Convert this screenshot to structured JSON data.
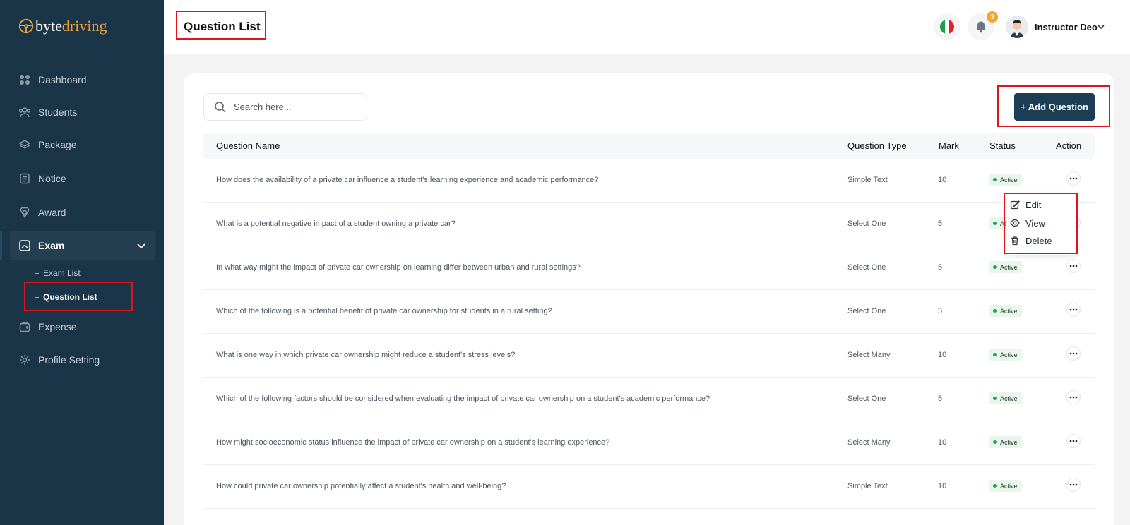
{
  "brand": {
    "name_part1": "byte",
    "name_part2": "driving"
  },
  "sidebar": {
    "items": [
      {
        "label": "Dashboard",
        "icon": "grid-icon"
      },
      {
        "label": "Students",
        "icon": "users-icon"
      },
      {
        "label": "Package",
        "icon": "layers-icon"
      },
      {
        "label": "Notice",
        "icon": "notice-icon"
      },
      {
        "label": "Award",
        "icon": "award-icon"
      },
      {
        "label": "Exam",
        "icon": "exam-icon"
      },
      {
        "label": "Expense",
        "icon": "wallet-icon"
      },
      {
        "label": "Profile Setting",
        "icon": "gear-icon"
      }
    ],
    "sub_items": [
      {
        "label": "Exam List"
      },
      {
        "label": "Question List"
      }
    ]
  },
  "header": {
    "title": "Question List",
    "notification_count": "3",
    "user_name": "Instructor Deo"
  },
  "search": {
    "placeholder": "Search here..."
  },
  "toolbar": {
    "add_label": "+ Add Question"
  },
  "table": {
    "columns": [
      "Question Name",
      "Question Type",
      "Mark",
      "Status",
      "Action"
    ],
    "rows": [
      {
        "name": "How does the availability of a private car influence a student's learning experience and academic performance?",
        "type": "Simple Text",
        "mark": "10",
        "status": "Active"
      },
      {
        "name": "What is a potential negative impact of a student owning a private car?",
        "type": "Select One",
        "mark": "5",
        "status": "Active"
      },
      {
        "name": "In what way might the impact of private car ownership on learning differ between urban and rural settings?",
        "type": "Select One",
        "mark": "5",
        "status": "Active"
      },
      {
        "name": "Which of the following is a potential benefit of private car ownership for students in a rural setting?",
        "type": "Select One",
        "mark": "5",
        "status": "Active"
      },
      {
        "name": "What is one way in which private car ownership might reduce a student's stress levels?",
        "type": "Select Many",
        "mark": "10",
        "status": "Active"
      },
      {
        "name": "Which of the following factors should be considered when evaluating the impact of private car ownership on a student's academic performance?",
        "type": "Select One",
        "mark": "5",
        "status": "Active"
      },
      {
        "name": "How might socioeconomic status influence the impact of private car ownership on a student's learning experience?",
        "type": "Select Many",
        "mark": "10",
        "status": "Active"
      },
      {
        "name": "How could private car ownership potentially affect a student's health and well-being?",
        "type": "Simple Text",
        "mark": "10",
        "status": "Active"
      }
    ]
  },
  "action_menu": {
    "edit": "Edit",
    "view": "View",
    "delete": "Delete"
  },
  "colors": {
    "sidebar_bg": "#1b3548",
    "accent": "#1b3e55",
    "brand_orange": "#f2a23a",
    "status_green": "#21a44a",
    "highlight_red": "#e0141c"
  }
}
